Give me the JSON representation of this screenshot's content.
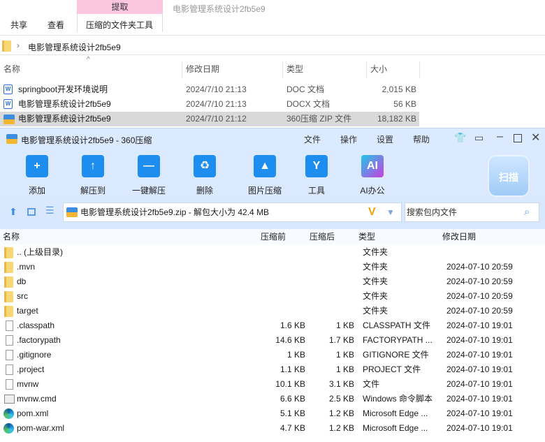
{
  "explorer": {
    "ribbon": {
      "context_tab": "提取",
      "window_title": "电影管理系统设计2fb5e9",
      "tabs": [
        "共享",
        "查看",
        "压缩的文件夹工具"
      ]
    },
    "breadcrumb": "电影管理系统设计2fb5e9",
    "columns": [
      "名称",
      "修改日期",
      "类型",
      "大小"
    ],
    "files": [
      {
        "name": "springboot开发环境说明",
        "date": "2024/7/10 21:13",
        "type": "DOC 文档",
        "size": "2,015 KB",
        "icon": "word-icon"
      },
      {
        "name": "电影管理系统设计2fb5e9",
        "date": "2024/7/10 21:13",
        "type": "DOCX 文档",
        "size": "56 KB",
        "icon": "word-icon"
      },
      {
        "name": "电影管理系统设计2fb5e9",
        "date": "2024/7/10 21:12",
        "type": "360压缩 ZIP 文件",
        "size": "18,182 KB",
        "icon": "zip-icon",
        "selected": true
      }
    ]
  },
  "zip": {
    "title": "电影管理系统设计2fb5e9 - 360压缩",
    "menu": [
      "文件",
      "操作",
      "设置",
      "帮助"
    ],
    "tools": [
      {
        "label": "添加",
        "glyph": "+"
      },
      {
        "label": "解压到",
        "glyph": "↑"
      },
      {
        "label": "一键解压",
        "glyph": "—"
      },
      {
        "label": "删除",
        "glyph": "♻"
      },
      {
        "label": "图片压缩",
        "glyph": "▲"
      },
      {
        "label": "工具",
        "glyph": "Y"
      },
      {
        "label": "AI办公",
        "glyph": "AI"
      }
    ],
    "scan": "扫描",
    "address": "电影管理系统设计2fb5e9.zip - 解包大小为 42.4 MB",
    "search_placeholder": "搜索包内文件",
    "columns": [
      "名称",
      "压缩前",
      "压缩后",
      "类型",
      "修改日期"
    ],
    "rows": [
      {
        "name": ".. (上级目录)",
        "before": "",
        "after": "",
        "type": "文件夹",
        "date": "",
        "icon": "folder"
      },
      {
        "name": ".mvn",
        "before": "",
        "after": "",
        "type": "文件夹",
        "date": "2024-07-10 20:59",
        "icon": "folder"
      },
      {
        "name": "db",
        "before": "",
        "after": "",
        "type": "文件夹",
        "date": "2024-07-10 20:59",
        "icon": "folder"
      },
      {
        "name": "src",
        "before": "",
        "after": "",
        "type": "文件夹",
        "date": "2024-07-10 20:59",
        "icon": "folder"
      },
      {
        "name": "target",
        "before": "",
        "after": "",
        "type": "文件夹",
        "date": "2024-07-10 20:59",
        "icon": "folder"
      },
      {
        "name": ".classpath",
        "before": "1.6 KB",
        "after": "1 KB",
        "type": "CLASSPATH 文件",
        "date": "2024-07-10 19:01",
        "icon": "file"
      },
      {
        "name": ".factorypath",
        "before": "14.6 KB",
        "after": "1.7 KB",
        "type": "FACTORYPATH ...",
        "date": "2024-07-10 19:01",
        "icon": "file"
      },
      {
        "name": ".gitignore",
        "before": "1 KB",
        "after": "1 KB",
        "type": "GITIGNORE 文件",
        "date": "2024-07-10 19:01",
        "icon": "file"
      },
      {
        "name": ".project",
        "before": "1.1 KB",
        "after": "1 KB",
        "type": "PROJECT 文件",
        "date": "2024-07-10 19:01",
        "icon": "file"
      },
      {
        "name": "mvnw",
        "before": "10.1 KB",
        "after": "3.1 KB",
        "type": "文件",
        "date": "2024-07-10 19:01",
        "icon": "file"
      },
      {
        "name": "mvnw.cmd",
        "before": "6.6 KB",
        "after": "2.5 KB",
        "type": "Windows 命令脚本",
        "date": "2024-07-10 19:01",
        "icon": "cmd"
      },
      {
        "name": "pom.xml",
        "before": "5.1 KB",
        "after": "1.2 KB",
        "type": "Microsoft Edge ...",
        "date": "2024-07-10 19:01",
        "icon": "edge"
      },
      {
        "name": "pom-war.xml",
        "before": "4.7 KB",
        "after": "1.2 KB",
        "type": "Microsoft Edge ...",
        "date": "2024-07-10 19:01",
        "icon": "edge"
      }
    ]
  }
}
